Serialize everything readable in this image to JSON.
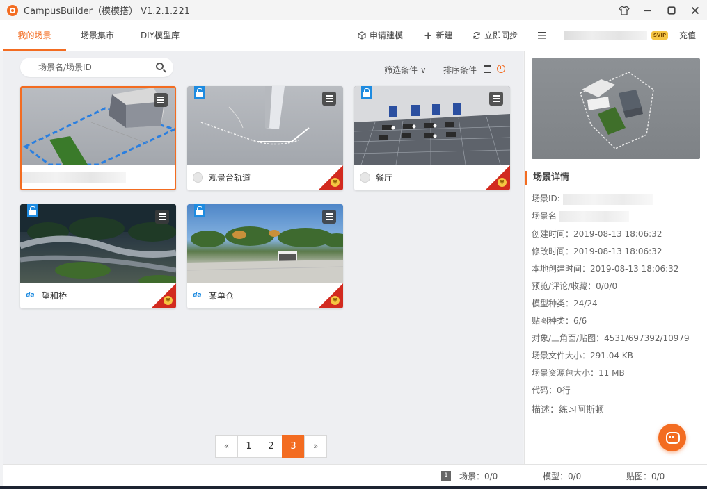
{
  "app": {
    "title": "CampusBuilder（模模搭） V1.2.1.221"
  },
  "window_controls": [
    "shirt-icon",
    "minimize-icon",
    "maximize-icon",
    "close-icon"
  ],
  "nav": {
    "tabs": [
      {
        "label": "我的场景",
        "active": true
      },
      {
        "label": "场景集市",
        "active": false
      },
      {
        "label": "DIY模型库",
        "active": false
      }
    ],
    "actions": [
      {
        "label": "申请建模",
        "icon": "cube-icon"
      },
      {
        "label": "新建",
        "icon": "plus-icon"
      },
      {
        "label": "立即同步",
        "icon": "sync-icon"
      }
    ],
    "menu_icon": "hamburger-icon",
    "vip_badge": "SVIP",
    "recharge": "充值"
  },
  "search": {
    "placeholder": "场景名/场景ID"
  },
  "toolbar": {
    "filter": "筛选条件 ∨",
    "sort": "排序条件"
  },
  "scenes": [
    {
      "name": "",
      "locked": false,
      "paid": false,
      "icon": "none",
      "selected": true,
      "theme": "grey"
    },
    {
      "name": "观景台轨道",
      "locked": true,
      "paid": true,
      "icon": "circle",
      "selected": false,
      "theme": "grey"
    },
    {
      "name": "餐厅",
      "locked": true,
      "paid": true,
      "icon": "circle",
      "selected": false,
      "theme": "dark"
    },
    {
      "name": "望和桥",
      "locked": true,
      "paid": true,
      "icon": "da",
      "selected": false,
      "theme": "night"
    },
    {
      "name": "某单仓",
      "locked": true,
      "paid": true,
      "icon": "da",
      "selected": false,
      "theme": "day"
    }
  ],
  "pagination": {
    "prev": "«",
    "pages": [
      "1",
      "2",
      "3"
    ],
    "current": "3",
    "next": "»"
  },
  "details": {
    "title": "场景详情",
    "id_label": "场景ID:",
    "name_label": "场景名",
    "created": "创建时间：2019-08-13 18:06:32",
    "modified": "修改时间：2019-08-13 18:06:32",
    "local_created": "本地创建时间：2019-08-13 18:06:32",
    "views": "预览/评论/收藏：0/0/0",
    "models": "模型种类：24/24",
    "textures": "贴图种类：6/6",
    "objects": "对象/三角面/贴图：4531/697392/10979",
    "file_size": "场景文件大小：291.04 KB",
    "pack_size": "场景资源包大小：11 MB",
    "code": "代码：0行",
    "desc": "描述：练习阿斯顿"
  },
  "status": {
    "badge": "1",
    "scenes": "场景：0/0",
    "models": "模型：0/0",
    "textures": "贴图：0/0"
  },
  "colors": {
    "accent": "#f36c21",
    "lock": "#1e8be0",
    "paid": "#d22a1f"
  }
}
